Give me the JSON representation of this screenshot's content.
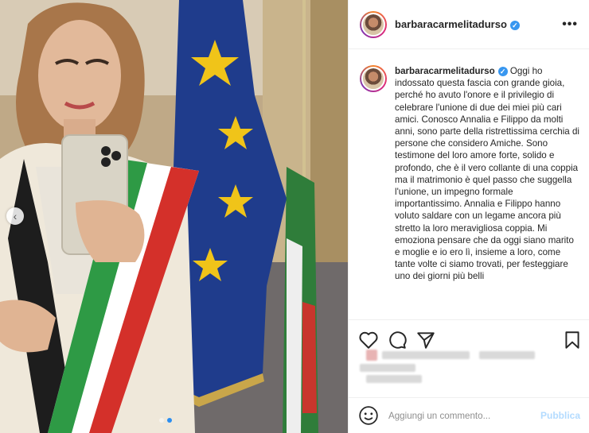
{
  "post": {
    "username": "barbaracarmelitadurso",
    "verified_badge": "✓",
    "more_label": "•••",
    "caption": "Oggi ho indossato questa fascia con grande gioia, perché ho avuto l'onore e il privilegio di celebrare l'unione di due dei miei più cari amici. Conosco Annalia e Filippo da molti anni, sono parte della ristrettissima cerchia di persone che considero Amiche. Sono testimone del loro amore forte, solido e profondo, che è il vero collante di una coppia ma il matrimonio è quel passo che suggella l'unione, un impegno formale importantissimo. Annalia e Filippo hanno voluto saldare con un legame ancora più stretto la loro meravigliosa coppia. Mi emoziona pensare che da oggi siano marito e moglie e io ero lì, insieme a loro, come tante volte ci siamo trovati, per festeggiare uno dei giorni più belli"
  },
  "comment": {
    "placeholder": "Aggiungi un commento...",
    "publish_label": "Pubblica"
  },
  "carousel": {
    "prev_label": "‹"
  },
  "icons": [
    "heart-icon",
    "comment-icon",
    "share-icon",
    "bookmark-icon",
    "emoji-icon",
    "verified-icon",
    "more-options-icon"
  ],
  "colors": {
    "verified": "#3897f0",
    "publish_disabled": "#b3dbff",
    "carousel_active_dot": "#2b8ef0"
  }
}
